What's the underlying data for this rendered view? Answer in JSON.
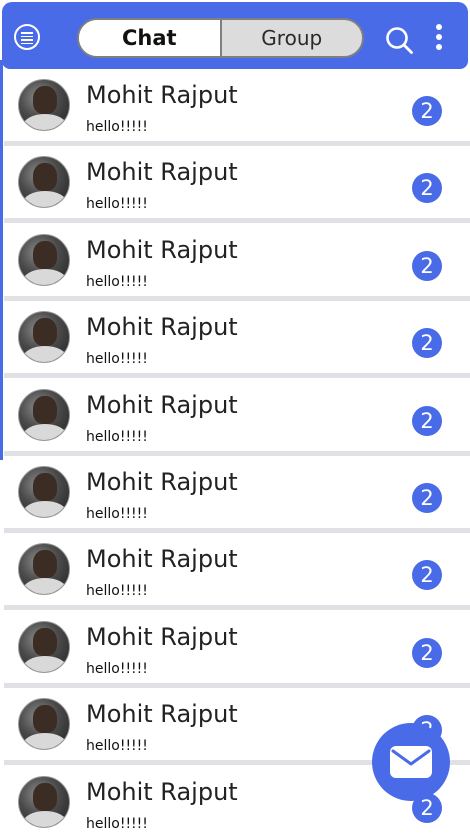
{
  "header": {
    "tabs": [
      {
        "label": "Chat",
        "active": true
      },
      {
        "label": "Group",
        "active": false
      }
    ],
    "icons": [
      "menu-icon",
      "search-icon",
      "more-vertical-icon"
    ]
  },
  "chats": [
    {
      "name": "Mohit Rajput",
      "message": "hello!!!!!",
      "unread": "2"
    },
    {
      "name": "Mohit Rajput",
      "message": "hello!!!!!",
      "unread": "2"
    },
    {
      "name": "Mohit Rajput",
      "message": "hello!!!!!",
      "unread": "2"
    },
    {
      "name": "Mohit Rajput",
      "message": "hello!!!!!",
      "unread": "2"
    },
    {
      "name": "Mohit Rajput",
      "message": "hello!!!!!",
      "unread": "2"
    },
    {
      "name": "Mohit Rajput",
      "message": "hello!!!!!",
      "unread": "2"
    },
    {
      "name": "Mohit Rajput",
      "message": "hello!!!!!",
      "unread": "2"
    },
    {
      "name": "Mohit Rajput",
      "message": "hello!!!!!",
      "unread": "2"
    },
    {
      "name": "Mohit Rajput",
      "message": "hello!!!!!",
      "unread": "2"
    },
    {
      "name": "Mohit Rajput",
      "message": "hello!!!!!",
      "unread": "2"
    }
  ],
  "fab": {
    "icon": "mail-icon"
  },
  "colors": {
    "accent": "#4a6be8",
    "divider": "#dfe1e4",
    "tab_inactive": "#dcdcdc"
  }
}
